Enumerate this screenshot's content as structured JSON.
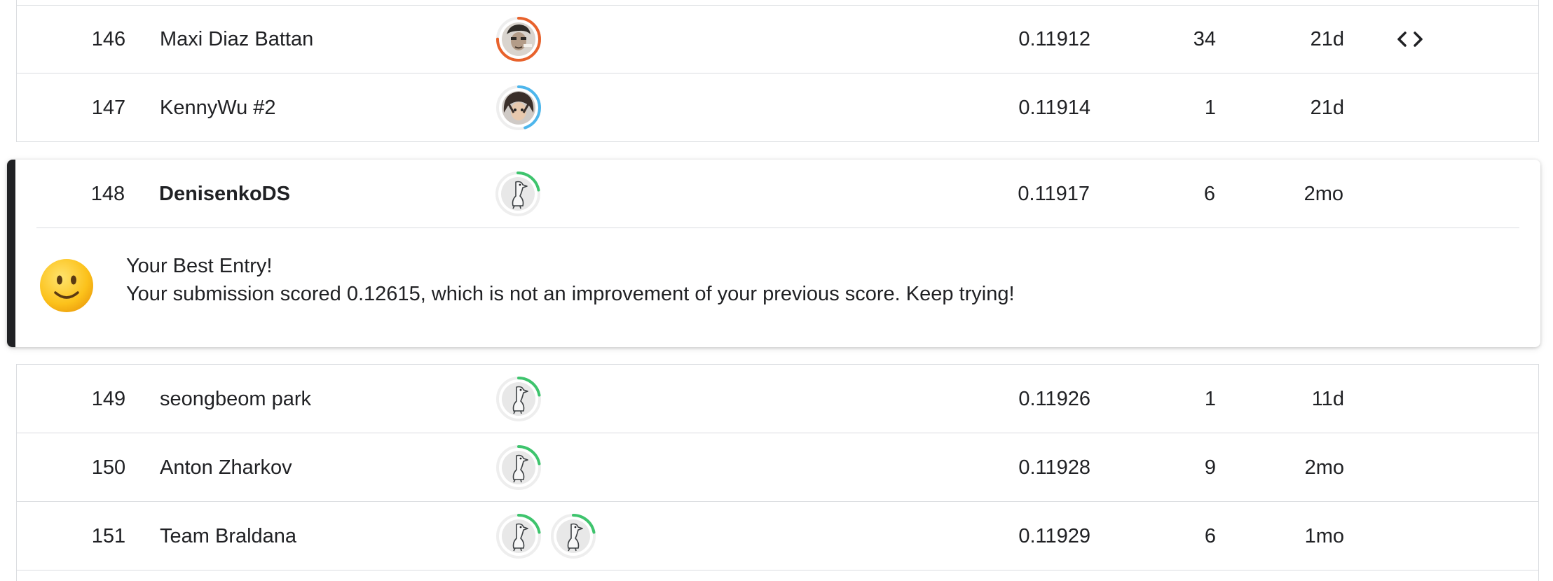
{
  "rows_top": [
    {
      "rank": "146",
      "name": "Maxi Diaz Battan",
      "avatars": [
        {
          "ring_color": "#e8622c",
          "kind": "photo-man"
        }
      ],
      "score": "0.11912",
      "entries": "34",
      "last": "21d",
      "has_code": true
    },
    {
      "rank": "147",
      "name": "KennyWu #2",
      "avatars": [
        {
          "ring_color": "#4db6ec",
          "kind": "photo-anime"
        }
      ],
      "score": "0.11914",
      "entries": "1",
      "last": "21d",
      "has_code": false
    }
  ],
  "highlight": {
    "rank": "148",
    "name": "DenisenkoDS",
    "avatars": [
      {
        "ring_color": "#3ec46d",
        "kind": "default-goose"
      }
    ],
    "score": "0.11917",
    "entries": "6",
    "last": "2mo",
    "feedback_title": "Your Best Entry!",
    "feedback_text": "Your submission scored 0.12615, which is not an improvement of your previous score. Keep trying!",
    "feedback_icon": "smiley-face-icon",
    "accent_color": "#202124"
  },
  "rows_bottom": [
    {
      "rank": "149",
      "name": "seongbeom park",
      "avatars": [
        {
          "ring_color": "#3ec46d",
          "kind": "default-goose"
        }
      ],
      "score": "0.11926",
      "entries": "1",
      "last": "11d",
      "has_code": false
    },
    {
      "rank": "150",
      "name": "Anton Zharkov",
      "avatars": [
        {
          "ring_color": "#3ec46d",
          "kind": "default-goose"
        }
      ],
      "score": "0.11928",
      "entries": "9",
      "last": "2mo",
      "has_code": false
    },
    {
      "rank": "151",
      "name": "Team Braldana",
      "avatars": [
        {
          "ring_color": "#3ec46d",
          "kind": "default-goose"
        },
        {
          "ring_color": "#3ec46d",
          "kind": "default-goose"
        }
      ],
      "score": "0.11929",
      "entries": "6",
      "last": "1mo",
      "has_code": false
    }
  ],
  "code_icon": "code-brackets-icon"
}
